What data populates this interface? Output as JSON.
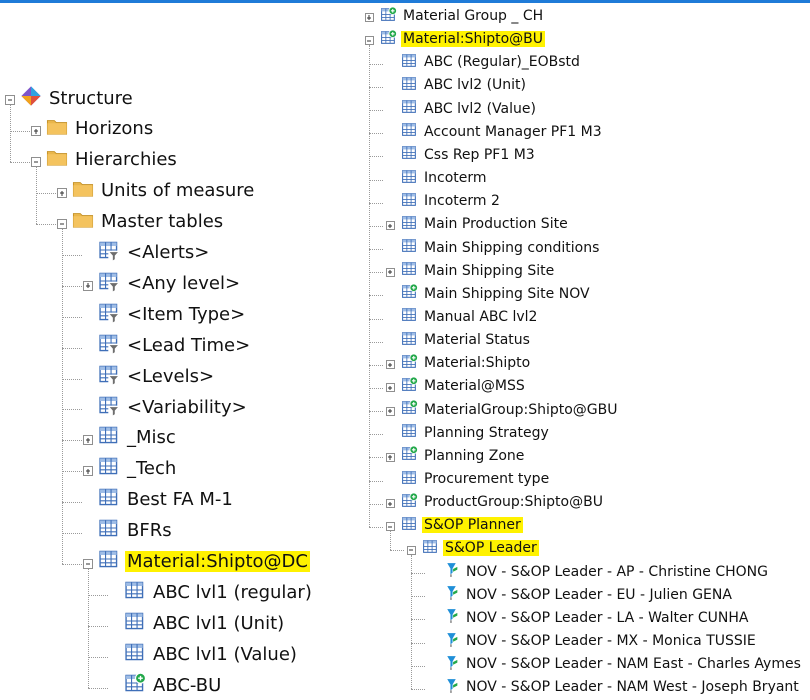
{
  "left_tree": [
    {
      "label": "Structure",
      "icon": "structure-icon",
      "depth": 0,
      "expander": "minus",
      "highlight": false
    },
    {
      "label": "Horizons",
      "icon": "folder-icon",
      "depth": 1,
      "expander": "plus",
      "highlight": false
    },
    {
      "label": "Hierarchies",
      "icon": "folder-icon",
      "depth": 1,
      "expander": "minus",
      "highlight": false
    },
    {
      "label": "Units of measure",
      "icon": "folder-icon",
      "depth": 2,
      "expander": "plus",
      "highlight": false
    },
    {
      "label": "Master tables",
      "icon": "folder-icon",
      "depth": 2,
      "expander": "minus",
      "highlight": false
    },
    {
      "label": "<Alerts>",
      "icon": "filter-table-icon",
      "depth": 3,
      "expander": "none",
      "highlight": false
    },
    {
      "label": "<Any level>",
      "icon": "filter-table-icon",
      "depth": 3,
      "expander": "plus",
      "highlight": false
    },
    {
      "label": "<Item Type>",
      "icon": "filter-table-icon",
      "depth": 3,
      "expander": "none",
      "highlight": false
    },
    {
      "label": "<Lead Time>",
      "icon": "filter-table-icon",
      "depth": 3,
      "expander": "none",
      "highlight": false
    },
    {
      "label": "<Levels>",
      "icon": "filter-table-icon",
      "depth": 3,
      "expander": "none",
      "highlight": false
    },
    {
      "label": "<Variability>",
      "icon": "filter-table-icon",
      "depth": 3,
      "expander": "none",
      "highlight": false
    },
    {
      "label": "_Misc",
      "icon": "table-icon",
      "depth": 3,
      "expander": "plus",
      "highlight": false
    },
    {
      "label": "_Tech",
      "icon": "table-icon",
      "depth": 3,
      "expander": "plus",
      "highlight": false
    },
    {
      "label": "Best FA M-1",
      "icon": "table-icon",
      "depth": 3,
      "expander": "none",
      "highlight": false
    },
    {
      "label": "BFRs",
      "icon": "table-icon",
      "depth": 3,
      "expander": "none",
      "highlight": false
    },
    {
      "label": "Material:Shipto@DC",
      "icon": "table-icon",
      "depth": 3,
      "expander": "minus",
      "highlight": true
    },
    {
      "label": "ABC lvl1 (regular)",
      "icon": "table-icon",
      "depth": 4,
      "expander": "none",
      "highlight": false
    },
    {
      "label": "ABC lvl1 (Unit)",
      "icon": "table-icon",
      "depth": 4,
      "expander": "none",
      "highlight": false
    },
    {
      "label": "ABC lvl1 (Value)",
      "icon": "table-icon",
      "depth": 4,
      "expander": "none",
      "highlight": false
    },
    {
      "label": "ABC-BU",
      "icon": "linked-table-icon",
      "depth": 4,
      "expander": "none",
      "highlight": false
    }
  ],
  "right_tree": [
    {
      "label": "Material Group _ CH",
      "icon": "linked-table-icon",
      "depth": 0,
      "expander": "plus",
      "highlight": false
    },
    {
      "label": "Material:Shipto@BU",
      "icon": "linked-table-icon",
      "depth": 0,
      "expander": "minus",
      "highlight": true
    },
    {
      "label": "ABC (Regular)_EOBstd",
      "icon": "table-icon",
      "depth": 1,
      "expander": "none",
      "highlight": false
    },
    {
      "label": "ABC lvl2 (Unit)",
      "icon": "table-icon",
      "depth": 1,
      "expander": "none",
      "highlight": false
    },
    {
      "label": "ABC lvl2 (Value)",
      "icon": "table-icon",
      "depth": 1,
      "expander": "none",
      "highlight": false
    },
    {
      "label": "Account Manager PF1 M3",
      "icon": "table-icon",
      "depth": 1,
      "expander": "none",
      "highlight": false
    },
    {
      "label": "Css Rep PF1 M3",
      "icon": "table-icon",
      "depth": 1,
      "expander": "none",
      "highlight": false
    },
    {
      "label": "Incoterm",
      "icon": "table-icon",
      "depth": 1,
      "expander": "none",
      "highlight": false
    },
    {
      "label": "Incoterm 2",
      "icon": "table-icon",
      "depth": 1,
      "expander": "none",
      "highlight": false
    },
    {
      "label": "Main Production Site",
      "icon": "table-icon",
      "depth": 1,
      "expander": "plus",
      "highlight": false
    },
    {
      "label": "Main Shipping conditions",
      "icon": "table-icon",
      "depth": 1,
      "expander": "none",
      "highlight": false
    },
    {
      "label": "Main Shipping Site",
      "icon": "table-icon",
      "depth": 1,
      "expander": "plus",
      "highlight": false
    },
    {
      "label": "Main Shipping Site NOV",
      "icon": "linked-table-icon",
      "depth": 1,
      "expander": "none",
      "highlight": false
    },
    {
      "label": "Manual ABC lvl2",
      "icon": "table-icon",
      "depth": 1,
      "expander": "none",
      "highlight": false
    },
    {
      "label": "Material Status",
      "icon": "table-icon",
      "depth": 1,
      "expander": "none",
      "highlight": false
    },
    {
      "label": "Material:Shipto",
      "icon": "linked-table-icon",
      "depth": 1,
      "expander": "plus",
      "highlight": false
    },
    {
      "label": "Material@MSS",
      "icon": "linked-table-icon",
      "depth": 1,
      "expander": "plus",
      "highlight": false
    },
    {
      "label": "MaterialGroup:Shipto@GBU",
      "icon": "linked-table-icon",
      "depth": 1,
      "expander": "plus",
      "highlight": false
    },
    {
      "label": "Planning Strategy",
      "icon": "table-icon",
      "depth": 1,
      "expander": "none",
      "highlight": false
    },
    {
      "label": "Planning Zone",
      "icon": "linked-table-icon",
      "depth": 1,
      "expander": "plus",
      "highlight": false
    },
    {
      "label": "Procurement type",
      "icon": "table-icon",
      "depth": 1,
      "expander": "none",
      "highlight": false
    },
    {
      "label": "ProductGroup:Shipto@BU",
      "icon": "linked-table-icon",
      "depth": 1,
      "expander": "plus",
      "highlight": false
    },
    {
      "label": "S&OP Planner",
      "icon": "table-icon",
      "depth": 1,
      "expander": "minus",
      "highlight": true
    },
    {
      "label": "S&OP Leader",
      "icon": "table-icon",
      "depth": 2,
      "expander": "minus",
      "highlight": true
    },
    {
      "label": "NOV - S&OP Leader - AP - Christine CHONG",
      "icon": "member-icon",
      "depth": 3,
      "expander": "none",
      "highlight": false
    },
    {
      "label": "NOV - S&OP Leader - EU - Julien GENA",
      "icon": "member-icon",
      "depth": 3,
      "expander": "none",
      "highlight": false
    },
    {
      "label": "NOV - S&OP Leader - LA - Walter CUNHA",
      "icon": "member-icon",
      "depth": 3,
      "expander": "none",
      "highlight": false
    },
    {
      "label": "NOV - S&OP Leader - MX - Monica TUSSIE",
      "icon": "member-icon",
      "depth": 3,
      "expander": "none",
      "highlight": false
    },
    {
      "label": "NOV - S&OP Leader - NAM East - Charles Aymes",
      "icon": "member-icon",
      "depth": 3,
      "expander": "none",
      "highlight": false
    },
    {
      "label": "NOV - S&OP Leader - NAM West - Joseph Bryant",
      "icon": "member-icon",
      "depth": 3,
      "expander": "none",
      "highlight": false
    }
  ],
  "colors": {
    "highlight": "#fff200",
    "folder": "#e9b64b",
    "table_grid": "#3f6fb8",
    "link_badge": "#22a84a",
    "accent_bar": "#1f7bd8"
  }
}
